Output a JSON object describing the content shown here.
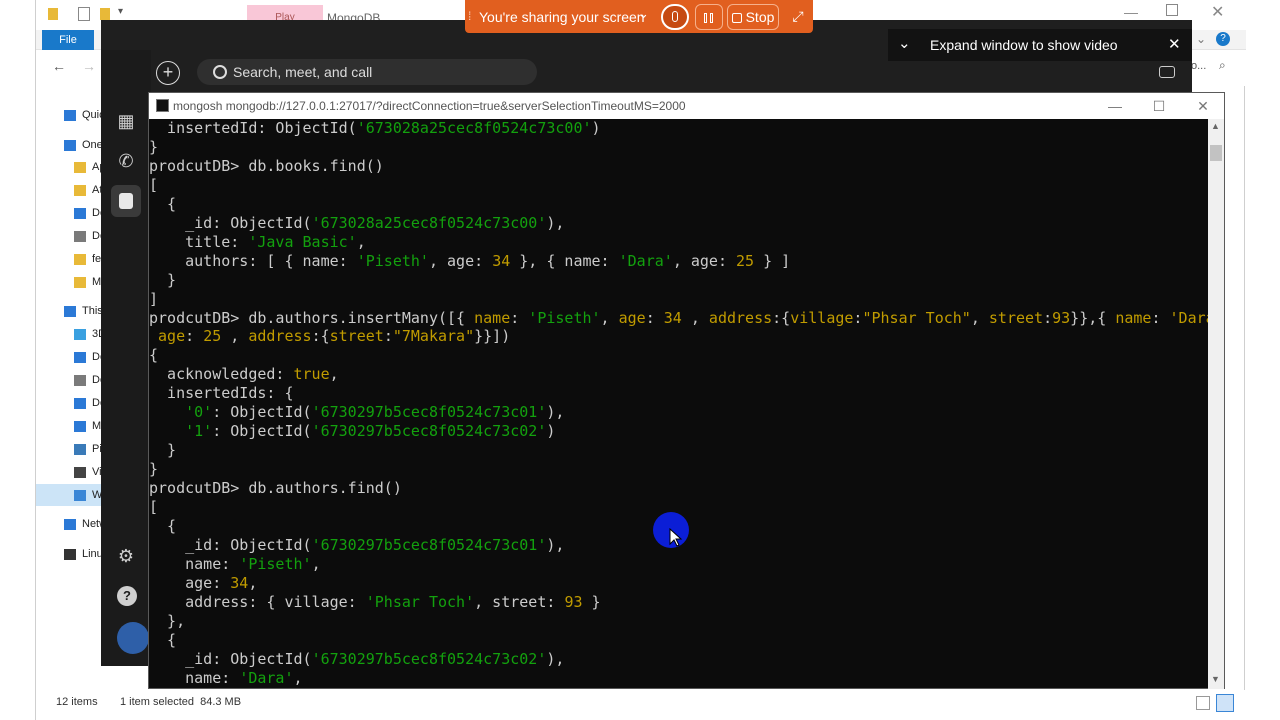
{
  "explorer": {
    "file_tab": "File",
    "play_tab": "Play",
    "window_tab": "MongoDB",
    "sidebar": [
      {
        "label": "Quick access",
        "icon": "star-icon",
        "color": "#2b79d6"
      },
      {
        "label": "OneDrive",
        "icon": "cloud-icon",
        "color": "#2b79d6"
      },
      {
        "label": "Ap",
        "icon": "folder-icon",
        "color": "#e8b938"
      },
      {
        "label": "At",
        "icon": "folder-icon",
        "color": "#e8b938"
      },
      {
        "label": "De",
        "icon": "desktop-icon",
        "color": "#2b79d6"
      },
      {
        "label": "Do",
        "icon": "document-icon",
        "color": "#7a7a7a"
      },
      {
        "label": "fe",
        "icon": "folder-icon",
        "color": "#e8b938"
      },
      {
        "label": "Mi",
        "icon": "folder-icon",
        "color": "#e8b938"
      },
      {
        "label": "This PC",
        "icon": "computer-icon",
        "color": "#2b79d6"
      },
      {
        "label": "3D",
        "icon": "cube-icon",
        "color": "#3aa0e0"
      },
      {
        "label": "De",
        "icon": "desktop-icon",
        "color": "#2b79d6"
      },
      {
        "label": "Do",
        "icon": "document-icon",
        "color": "#7a7a7a"
      },
      {
        "label": "Do",
        "icon": "download-icon",
        "color": "#2b79d6"
      },
      {
        "label": "Mu",
        "icon": "music-icon",
        "color": "#2b79d6"
      },
      {
        "label": "Pic",
        "icon": "picture-icon",
        "color": "#3a7ab8"
      },
      {
        "label": "Vic",
        "icon": "video-icon",
        "color": "#444444"
      },
      {
        "label": "Wi",
        "icon": "drive-icon",
        "color": "#3a86d6"
      },
      {
        "label": "Network",
        "icon": "network-icon",
        "color": "#2b79d6"
      },
      {
        "label": "Linux",
        "icon": "linux-icon",
        "color": "#333333"
      }
    ],
    "status_items": "12 items",
    "status_selected": "1 item selected  84.3 MB",
    "search_hint": "o..."
  },
  "teams": {
    "search_placeholder": "Search, meet, and call",
    "rail_icons": [
      "calendar-icon",
      "calls-icon",
      "contacts-icon",
      "settings-icon",
      "help-icon",
      "apps-icon"
    ]
  },
  "share_bar": {
    "text": "You're sharing your screen",
    "stop_label": "Stop",
    "color": "#e15f1f"
  },
  "expand_popup": {
    "text": "Expand window to show video"
  },
  "terminal": {
    "title": "mongosh mongodb://127.0.0.1:27017/?directConnection=true&serverSelectionTimeoutMS=2000",
    "lines": [
      [
        {
          "t": "  insertedId: ObjectId(",
          "c": ""
        },
        {
          "t": "'673028a25cec8f0524c73c00'",
          "c": "s"
        },
        {
          "t": ")",
          "c": ""
        }
      ],
      [
        {
          "t": "}",
          "c": ""
        }
      ],
      [
        {
          "t": "prodcutDB> db.books.find()",
          "c": ""
        }
      ],
      [
        {
          "t": "[",
          "c": ""
        }
      ],
      [
        {
          "t": "  {",
          "c": ""
        }
      ],
      [
        {
          "t": "    _id: ObjectId(",
          "c": ""
        },
        {
          "t": "'673028a25cec8f0524c73c00'",
          "c": "s"
        },
        {
          "t": "),",
          "c": ""
        }
      ],
      [
        {
          "t": "    title: ",
          "c": ""
        },
        {
          "t": "'Java Basic'",
          "c": "s"
        },
        {
          "t": ",",
          "c": ""
        }
      ],
      [
        {
          "t": "    authors: [ { name: ",
          "c": ""
        },
        {
          "t": "'Piseth'",
          "c": "s"
        },
        {
          "t": ", age: ",
          "c": ""
        },
        {
          "t": "34",
          "c": "n"
        },
        {
          "t": " }, { name: ",
          "c": ""
        },
        {
          "t": "'Dara'",
          "c": "s"
        },
        {
          "t": ", age: ",
          "c": ""
        },
        {
          "t": "25",
          "c": "n"
        },
        {
          "t": " } ]",
          "c": ""
        }
      ],
      [
        {
          "t": "  }",
          "c": ""
        }
      ],
      [
        {
          "t": "]",
          "c": ""
        }
      ],
      [
        {
          "t": "prodcutDB> db.authors.insertMany([{ ",
          "c": ""
        },
        {
          "t": "name",
          "c": "n"
        },
        {
          "t": ": ",
          "c": ""
        },
        {
          "t": "'Piseth'",
          "c": "s"
        },
        {
          "t": ", ",
          "c": ""
        },
        {
          "t": "age",
          "c": "n"
        },
        {
          "t": ": ",
          "c": ""
        },
        {
          "t": "34",
          "c": "n"
        },
        {
          "t": " , ",
          "c": ""
        },
        {
          "t": "address",
          "c": "n"
        },
        {
          "t": ":{",
          "c": ""
        },
        {
          "t": "village",
          "c": "n"
        },
        {
          "t": ":",
          "c": ""
        },
        {
          "t": "\"Phsar Toch\"",
          "c": "n"
        },
        {
          "t": ", ",
          "c": ""
        },
        {
          "t": "street",
          "c": "n"
        },
        {
          "t": ":",
          "c": ""
        },
        {
          "t": "93",
          "c": "n"
        },
        {
          "t": "}},{ ",
          "c": ""
        },
        {
          "t": "name",
          "c": "n"
        },
        {
          "t": ": ",
          "c": ""
        },
        {
          "t": "'Dara'",
          "c": "n"
        },
        {
          "t": ",",
          "c": ""
        }
      ],
      [
        {
          "t": " ",
          "c": ""
        },
        {
          "t": "age",
          "c": "n"
        },
        {
          "t": ": ",
          "c": ""
        },
        {
          "t": "25",
          "c": "n"
        },
        {
          "t": " , ",
          "c": ""
        },
        {
          "t": "address",
          "c": "n"
        },
        {
          "t": ":{",
          "c": ""
        },
        {
          "t": "street",
          "c": "n"
        },
        {
          "t": ":",
          "c": ""
        },
        {
          "t": "\"7Makara\"",
          "c": "n"
        },
        {
          "t": "}}])",
          "c": ""
        }
      ],
      [
        {
          "t": "{",
          "c": ""
        }
      ],
      [
        {
          "t": "  acknowledged: ",
          "c": ""
        },
        {
          "t": "true",
          "c": "n"
        },
        {
          "t": ",",
          "c": ""
        }
      ],
      [
        {
          "t": "  insertedIds: {",
          "c": ""
        }
      ],
      [
        {
          "t": "    ",
          "c": ""
        },
        {
          "t": "'0'",
          "c": "s"
        },
        {
          "t": ": ObjectId(",
          "c": ""
        },
        {
          "t": "'6730297b5cec8f0524c73c01'",
          "c": "s"
        },
        {
          "t": "),",
          "c": ""
        }
      ],
      [
        {
          "t": "    ",
          "c": ""
        },
        {
          "t": "'1'",
          "c": "s"
        },
        {
          "t": ": ObjectId(",
          "c": ""
        },
        {
          "t": "'6730297b5cec8f0524c73c02'",
          "c": "s"
        },
        {
          "t": ")",
          "c": ""
        }
      ],
      [
        {
          "t": "  }",
          "c": ""
        }
      ],
      [
        {
          "t": "}",
          "c": ""
        }
      ],
      [
        {
          "t": "prodcutDB> db.authors.find()",
          "c": ""
        }
      ],
      [
        {
          "t": "[",
          "c": ""
        }
      ],
      [
        {
          "t": "  {",
          "c": ""
        }
      ],
      [
        {
          "t": "    _id: ObjectId(",
          "c": ""
        },
        {
          "t": "'6730297b5cec8f0524c73c01'",
          "c": "s"
        },
        {
          "t": "),",
          "c": ""
        }
      ],
      [
        {
          "t": "    name: ",
          "c": ""
        },
        {
          "t": "'Piseth'",
          "c": "s"
        },
        {
          "t": ",",
          "c": ""
        }
      ],
      [
        {
          "t": "    age: ",
          "c": ""
        },
        {
          "t": "34",
          "c": "n"
        },
        {
          "t": ",",
          "c": ""
        }
      ],
      [
        {
          "t": "    address: { village: ",
          "c": ""
        },
        {
          "t": "'Phsar Toch'",
          "c": "s"
        },
        {
          "t": ", street: ",
          "c": ""
        },
        {
          "t": "93",
          "c": "n"
        },
        {
          "t": " }",
          "c": ""
        }
      ],
      [
        {
          "t": "  },",
          "c": ""
        }
      ],
      [
        {
          "t": "  {",
          "c": ""
        }
      ],
      [
        {
          "t": "    _id: ObjectId(",
          "c": ""
        },
        {
          "t": "'6730297b5cec8f0524c73c02'",
          "c": "s"
        },
        {
          "t": "),",
          "c": ""
        }
      ],
      [
        {
          "t": "    name: ",
          "c": ""
        },
        {
          "t": "'Dara'",
          "c": "s"
        },
        {
          "t": ",",
          "c": ""
        }
      ]
    ]
  }
}
